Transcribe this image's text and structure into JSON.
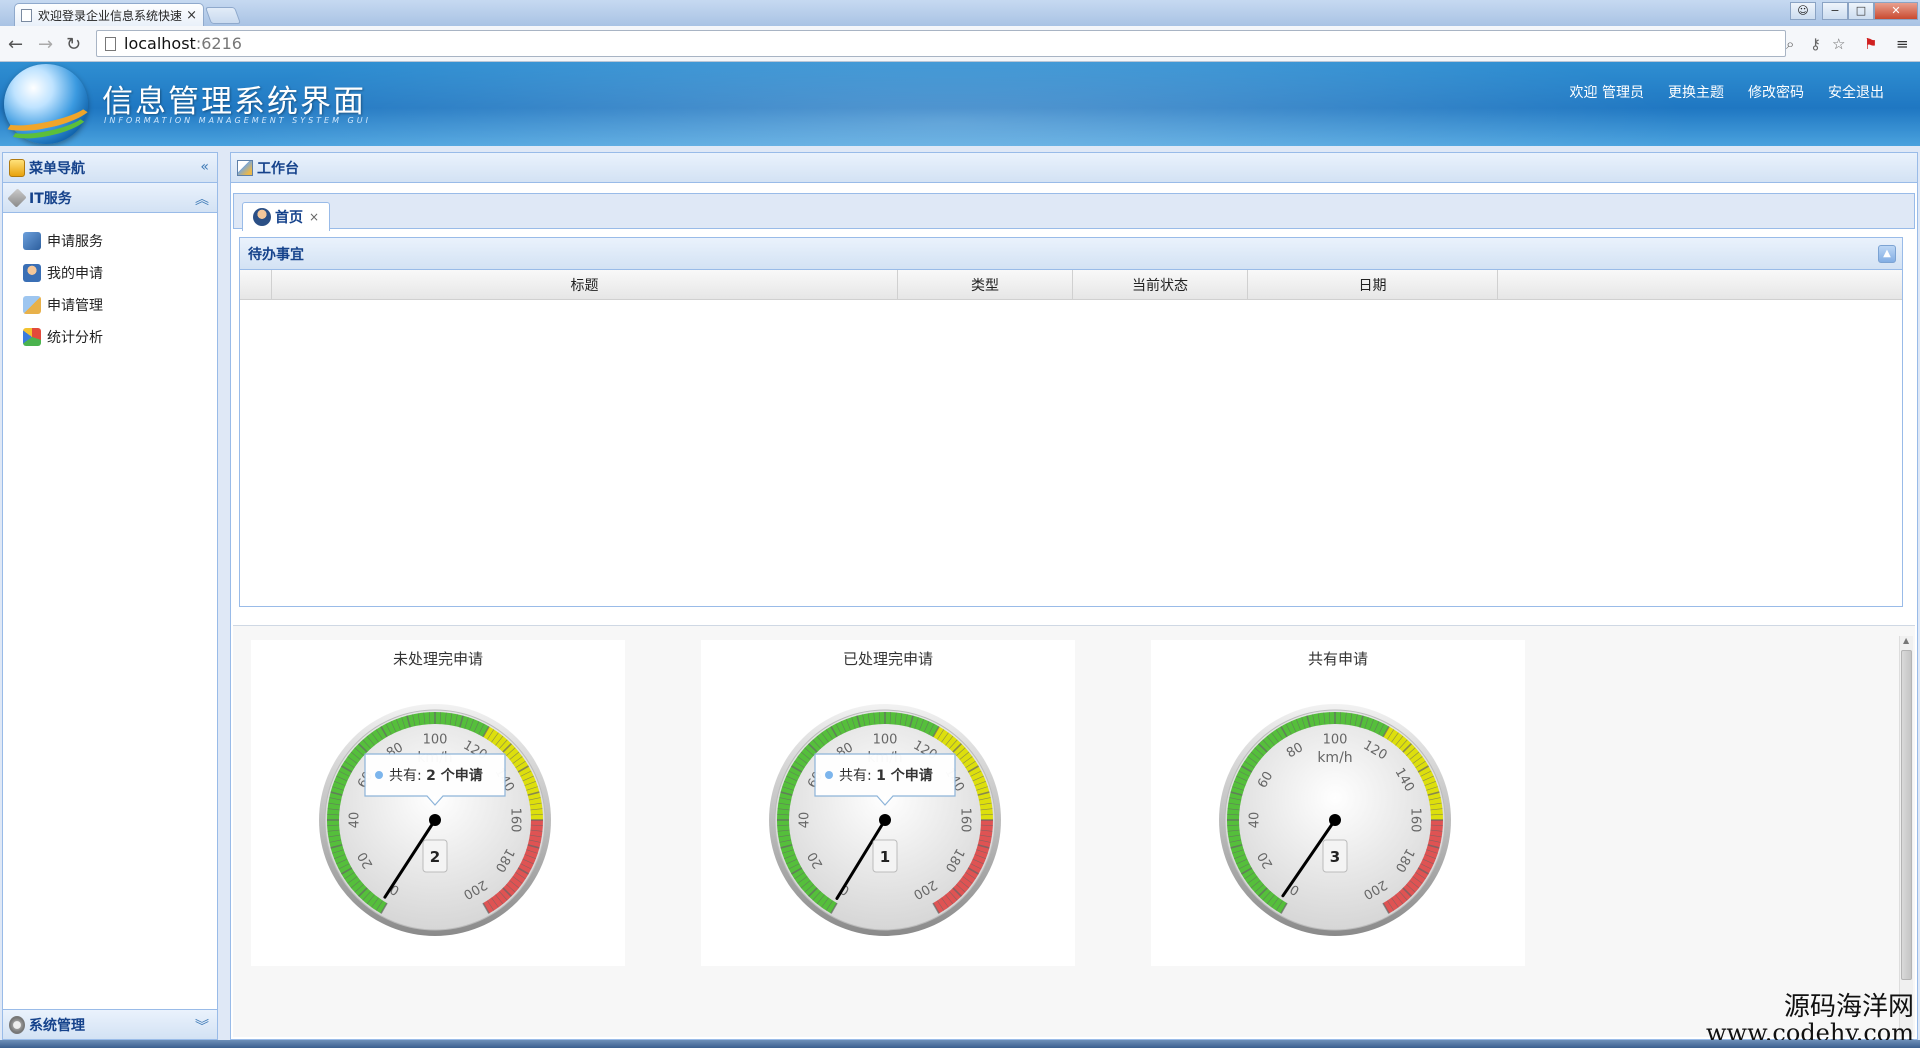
{
  "browser": {
    "tab_title": "欢迎登录企业信息系统快速",
    "tab_close": "×",
    "url_host": "localhost",
    "url_port": ":6216",
    "window_controls": [
      "−",
      "□",
      "✕"
    ]
  },
  "header": {
    "title": "信息管理系统界面",
    "subtitle": "INFORMATION MANAGEMENT SYSTEM GUI",
    "links": [
      "欢迎 管理员",
      "更换主题",
      "修改密码",
      "安全退出"
    ]
  },
  "sidebar": {
    "panel_title": "菜单导航",
    "collapse_icon": "«",
    "group_title": "IT服务",
    "group_icon": "︽",
    "items": [
      {
        "label": "申请服务",
        "icon": "apply-service-icon"
      },
      {
        "label": "我的申请",
        "icon": "my-apply-icon"
      },
      {
        "label": "申请管理",
        "icon": "apply-manage-icon"
      },
      {
        "label": "统计分析",
        "icon": "stats-icon"
      }
    ],
    "system_title": "系统管理",
    "system_icon": "︾"
  },
  "main": {
    "title": "工作台",
    "home_tab": "首页",
    "home_tab_close": "×",
    "todo": {
      "title": "待办事宜",
      "columns": [
        "标题",
        "类型",
        "当前状态",
        "日期"
      ]
    },
    "gauges": [
      {
        "title": "未处理完申请",
        "value": 2,
        "tooltip_prefix": "共有:",
        "tooltip_value": "2",
        "tooltip_suffix": "个申请",
        "show_tooltip": true
      },
      {
        "title": "已处理完申请",
        "value": 1,
        "tooltip_prefix": "共有:",
        "tooltip_value": "1",
        "tooltip_suffix": "个申请",
        "show_tooltip": true
      },
      {
        "title": "共有申请",
        "value": 3,
        "tooltip_prefix": "",
        "tooltip_value": "",
        "tooltip_suffix": "",
        "show_tooltip": false
      }
    ],
    "gauge_scale": {
      "min": 0,
      "max": 200,
      "ticks": [
        0,
        20,
        40,
        60,
        80,
        100,
        120,
        140,
        160,
        180,
        200
      ],
      "unit": "km/h"
    }
  },
  "watermark": {
    "line1": "源码海洋网",
    "line2": "www.codehy.com"
  }
}
